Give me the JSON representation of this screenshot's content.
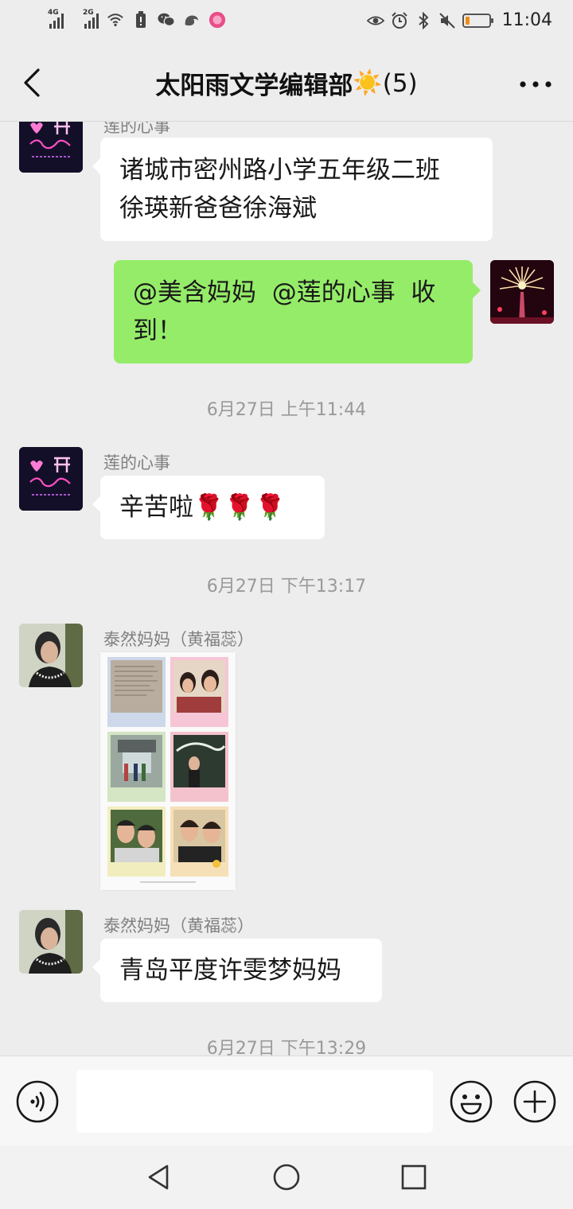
{
  "status_bar": {
    "network_1": "4G",
    "network_2": "2G",
    "time": "11:04",
    "battery_level": 0.18,
    "battery_color": "#f08c1a"
  },
  "header": {
    "title": "太阳雨文学编辑部",
    "title_emoji": "☀️",
    "member_count": "(5)"
  },
  "messages": [
    {
      "sender": "莲的心事",
      "text_lines": [
        "诸城市密州路小学五年级二班",
        "徐瑛新爸爸徐海斌"
      ]
    },
    {
      "self": true,
      "text_lines": [
        "@美含妈妈  @莲的心事  收",
        "到！"
      ]
    },
    {
      "timestamp": "6月27日 上午11:44"
    },
    {
      "sender": "莲的心事",
      "text": "辛苦啦🌹🌹🌹"
    },
    {
      "timestamp": "6月27日 下午13:17"
    },
    {
      "sender": "泰然妈妈（黄福蕊）",
      "image": "photo-collage"
    },
    {
      "sender": "泰然妈妈（黄福蕊）",
      "text": "青岛平度许雯梦妈妈"
    },
    {
      "timestamp": "6月27日 下午13:29"
    }
  ],
  "input": {
    "value": "",
    "placeholder": ""
  },
  "icons": {
    "back": "back-arrow-icon",
    "more": "more-icon",
    "voice": "voice-icon",
    "emoji": "emoji-icon",
    "plus": "plus-icon"
  },
  "colors": {
    "self_bubble": "#95ec69",
    "other_bubble": "#ffffff",
    "background": "#ededed"
  }
}
